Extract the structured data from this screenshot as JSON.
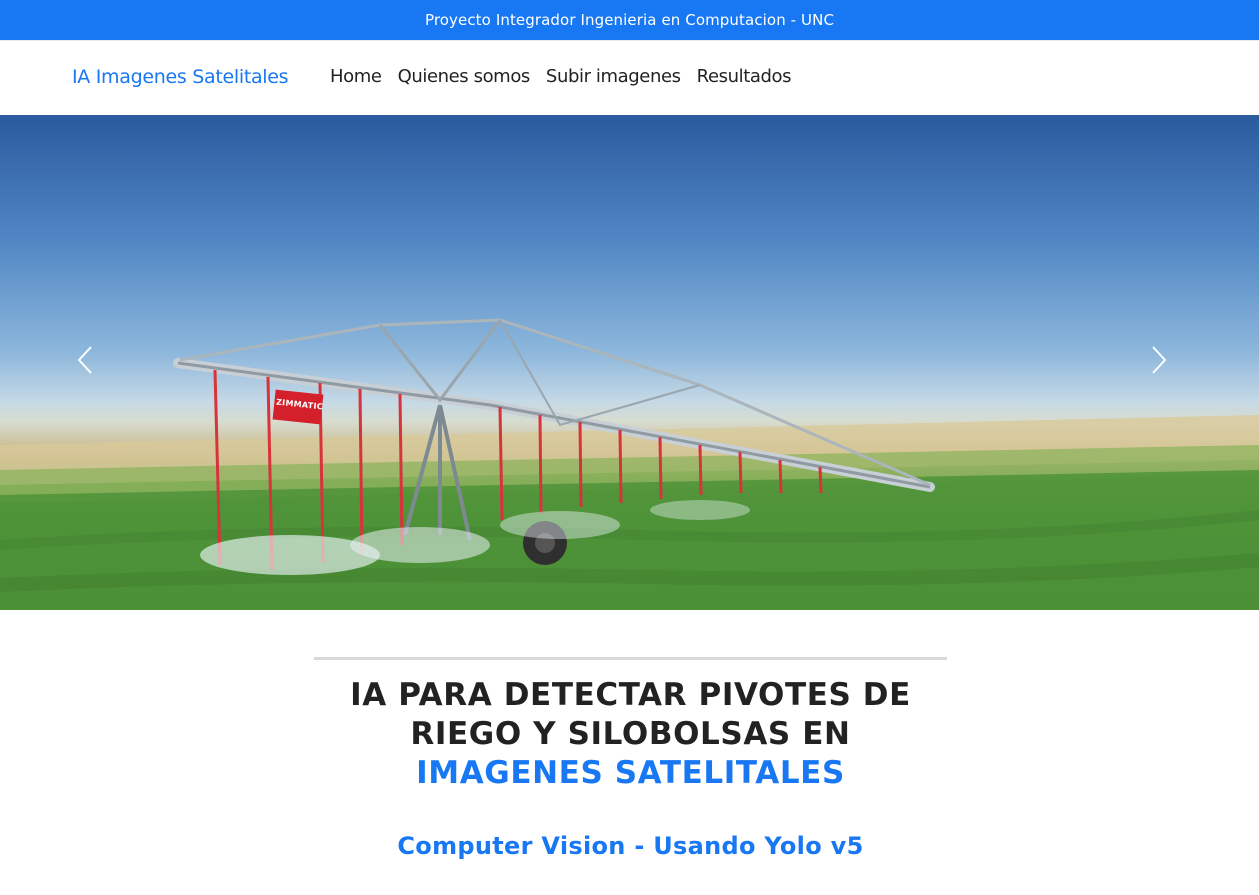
{
  "topbar": {
    "text": "Proyecto Integrador Ingenieria en Computacion - UNC"
  },
  "navbar": {
    "brand": "IA Imagenes Satelitales",
    "links": [
      "Home",
      "Quienes somos",
      "Subir imagenes",
      "Resultados"
    ]
  },
  "hero": {
    "image_label": "ZIMMATIC",
    "prev_icon": "chevron-left-icon",
    "next_icon": "chevron-right-icon"
  },
  "headline": {
    "part1": "IA PARA DETECTAR PIVOTES DE RIEGO Y SILOBOLSAS EN ",
    "accent": "IMAGENES SATELITALES"
  },
  "subheadline": "Computer Vision - Usando Yolo v5",
  "colors": {
    "accent": "#1877f2",
    "text": "#222222",
    "divider": "#d9d9d9"
  }
}
